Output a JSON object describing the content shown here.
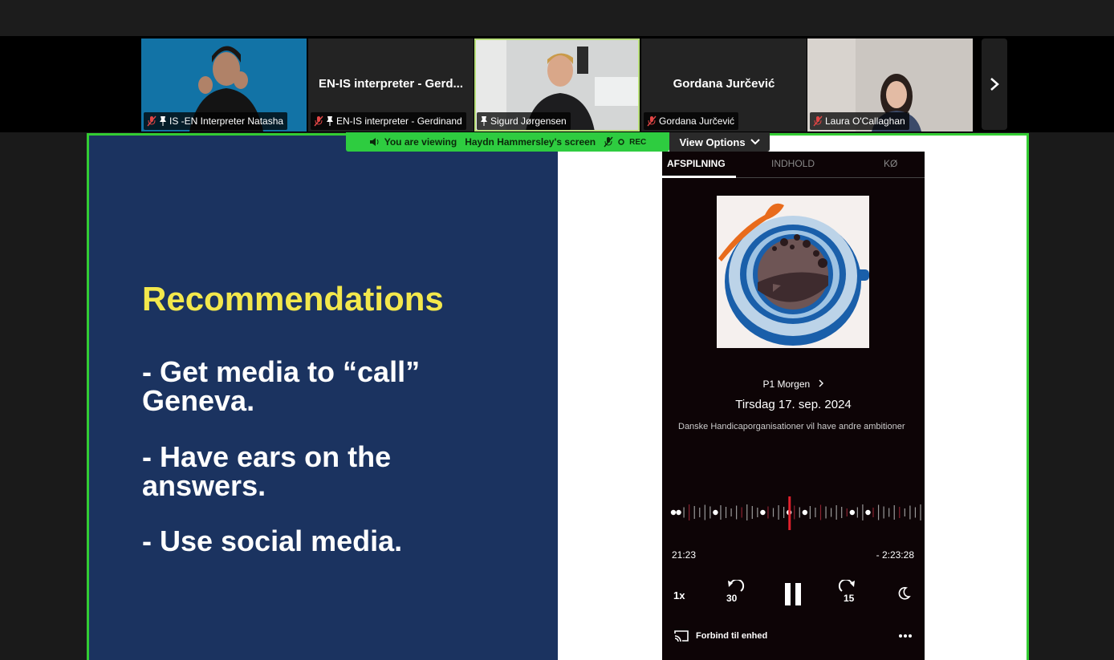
{
  "participants": [
    {
      "label": "IS -EN Interpreter Natasha",
      "pinned": true,
      "muted": true
    },
    {
      "display_name": "EN-IS interpreter - Gerd...",
      "label": "EN-IS interpreter - Gerdinand",
      "pinned": true,
      "muted": true
    },
    {
      "label": "Sigurd Jørgensen",
      "pinned": true,
      "muted": false,
      "active_speaker": true
    },
    {
      "display_name": "Gordana Jurčević",
      "label": "Gordana Jurčević",
      "muted": true
    },
    {
      "label": "Laura O'Callaghan",
      "muted": true
    }
  ],
  "share_banner": {
    "prefix": "You are viewing",
    "presenter": "Haydn Hammersley's screen",
    "rec": "REC",
    "view_options": "View Options"
  },
  "slide": {
    "title": "Recommendations",
    "bullets": [
      "- Get media to “call” Geneva.",
      "- Have ears on the answers.",
      "- Use social media."
    ]
  },
  "player": {
    "tabs": [
      "AFSPILNING",
      "INDHOLD",
      "KØ"
    ],
    "show": "P1 Morgen",
    "date": "Tirsdag 17. sep. 2024",
    "description": "Danske Handicaporganisationer vil have andre ambitioner",
    "elapsed": "21:23",
    "remaining": "- 2:23:28",
    "speed": "1x",
    "rewind": "30",
    "forward": "15",
    "cast": "Forbind til enhed",
    "progress": 0.13
  },
  "colors": {
    "share_border": "#33cc33",
    "slide_bg": "#1b3360",
    "slide_title": "#f3e84c",
    "player_bg": "#0d0406",
    "scrub_marker": "#e0202c"
  }
}
